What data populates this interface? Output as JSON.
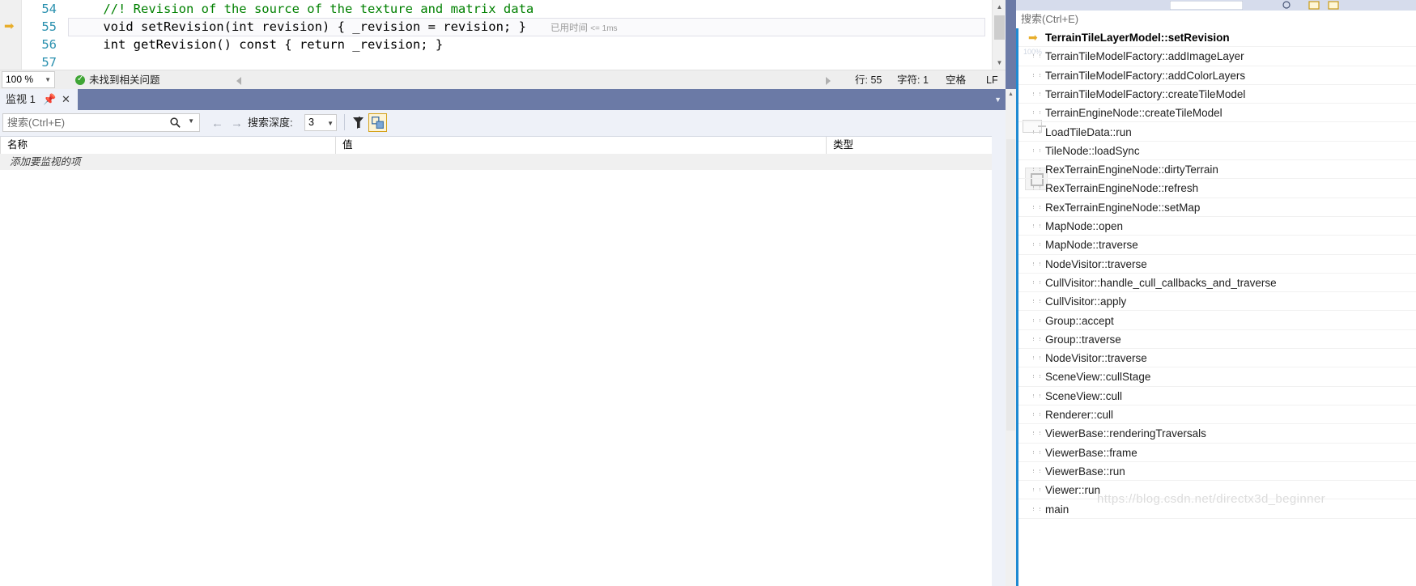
{
  "editor": {
    "lines": [
      {
        "number": "54",
        "text": "    //! Revision of the source of the texture and matrix data",
        "comment": true
      },
      {
        "number": "55",
        "text": "    void setRevision(int revision) { _revision = revision; }",
        "comment": false
      },
      {
        "number": "56",
        "text": "    int getRevision() const { return _revision; }",
        "comment": false
      },
      {
        "number": "57",
        "text": "",
        "comment": false
      }
    ],
    "elapsed_label": "已用时间",
    "elapsed_value": "<= 1ms",
    "current_line_marker": "current-statement-arrow"
  },
  "editor_status": {
    "zoom": "100 %",
    "issue_text": "未找到相关问题",
    "line_label": "行: 55",
    "char_label": "字符: 1",
    "spaces_label": "空格",
    "eol_label": "LF"
  },
  "watch": {
    "tab_label": "监视 1",
    "pin_icon": "pin-icon",
    "close_icon": "close-icon",
    "search_placeholder": "搜索(Ctrl+E)",
    "depth_label": "搜索深度:",
    "depth_value": "3",
    "filter_icon": "filter-icon",
    "hex_icon": "hexadecimal-display-icon",
    "columns": [
      "名称",
      "值",
      "类型"
    ],
    "empty_row_text": "添加要监视的项"
  },
  "callstack": {
    "search_placeholder": "搜索(Ctrl+E)",
    "frames": [
      {
        "label": "TerrainTileLayerModel::setRevision",
        "active": true
      },
      {
        "label": "TerrainTileModelFactory::addImageLayer",
        "active": false
      },
      {
        "label": "TerrainTileModelFactory::addColorLayers",
        "active": false
      },
      {
        "label": "TerrainTileModelFactory::createTileModel",
        "active": false
      },
      {
        "label": "TerrainEngineNode::createTileModel",
        "active": false
      },
      {
        "label": "LoadTileData::run",
        "active": false
      },
      {
        "label": "TileNode::loadSync",
        "active": false
      },
      {
        "label": "RexTerrainEngineNode::dirtyTerrain",
        "active": false
      },
      {
        "label": "RexTerrainEngineNode::refresh",
        "active": false
      },
      {
        "label": "RexTerrainEngineNode::setMap",
        "active": false
      },
      {
        "label": "MapNode::open",
        "active": false
      },
      {
        "label": "MapNode::traverse",
        "active": false
      },
      {
        "label": "NodeVisitor::traverse",
        "active": false
      },
      {
        "label": "CullVisitor::handle_cull_callbacks_and_traverse",
        "active": false
      },
      {
        "label": "CullVisitor::apply",
        "active": false
      },
      {
        "label": "Group::accept",
        "active": false
      },
      {
        "label": "Group::traverse",
        "active": false
      },
      {
        "label": "NodeVisitor::traverse",
        "active": false
      },
      {
        "label": "SceneView::cullStage",
        "active": false
      },
      {
        "label": "SceneView::cull",
        "active": false
      },
      {
        "label": "Renderer::cull",
        "active": false
      },
      {
        "label": "ViewerBase::renderingTraversals",
        "active": false
      },
      {
        "label": "ViewerBase::frame",
        "active": false
      },
      {
        "label": "ViewerBase::run",
        "active": false
      },
      {
        "label": "Viewer::run",
        "active": false
      },
      {
        "label": "main",
        "active": false
      }
    ],
    "zoom_badge": "100%"
  },
  "watermark": "https://blog.csdn.net/directx3d_beginner",
  "colors": {
    "accent_blue": "#1f8ad2",
    "panel_chrome": "#6b7aa6",
    "line_number": "#2b91af",
    "comment_green": "#008000",
    "breakpoint_yellow": "#e8ae2b"
  }
}
